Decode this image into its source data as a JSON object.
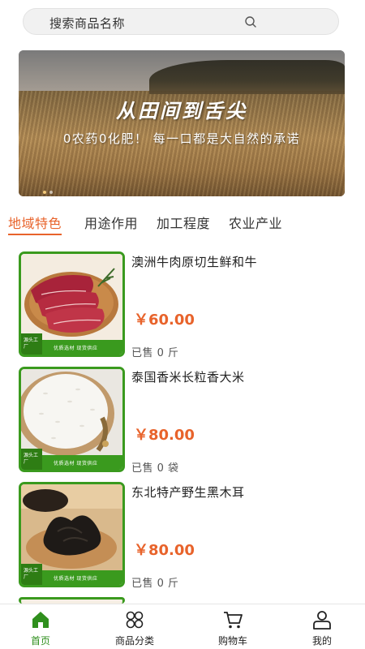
{
  "search": {
    "placeholder": "搜索商品名称",
    "icon": "search-icon"
  },
  "banner": {
    "title": "从田间到舌尖",
    "subtitle": "0农药0化肥！ 每一口都是大自然的承诺",
    "active_dot": 1,
    "dot_count": 2
  },
  "tabs": [
    {
      "label": "地域特色",
      "active": true
    },
    {
      "label": "用途作用",
      "active": false
    },
    {
      "label": "加工程度",
      "active": false
    },
    {
      "label": "农业产业",
      "active": false
    }
  ],
  "products": [
    {
      "name": "澳洲牛肉原切生鲜和牛",
      "price": "￥60.00",
      "sold": "已售 0 斤",
      "badge": "源头工厂",
      "tag": "优质选材 现货供应"
    },
    {
      "name": "泰国香米长粒香大米",
      "price": "￥80.00",
      "sold": "已售 0 袋",
      "badge": "源头工厂",
      "tag": "优质选材 现货供应"
    },
    {
      "name": "东北特产野生黑木耳",
      "price": "￥80.00",
      "sold": "已售 0 斤",
      "badge": "源头工厂",
      "tag": "优质选材 现货供应"
    }
  ],
  "tabbar": [
    {
      "label": "首页",
      "icon": "home-icon",
      "active": true
    },
    {
      "label": "商品分类",
      "icon": "category-icon",
      "active": false
    },
    {
      "label": "购物车",
      "icon": "cart-icon",
      "active": false
    },
    {
      "label": "我的",
      "icon": "user-icon",
      "active": false
    }
  ],
  "colors": {
    "accent": "#e8632b",
    "brand_green": "#2f8f1d"
  }
}
